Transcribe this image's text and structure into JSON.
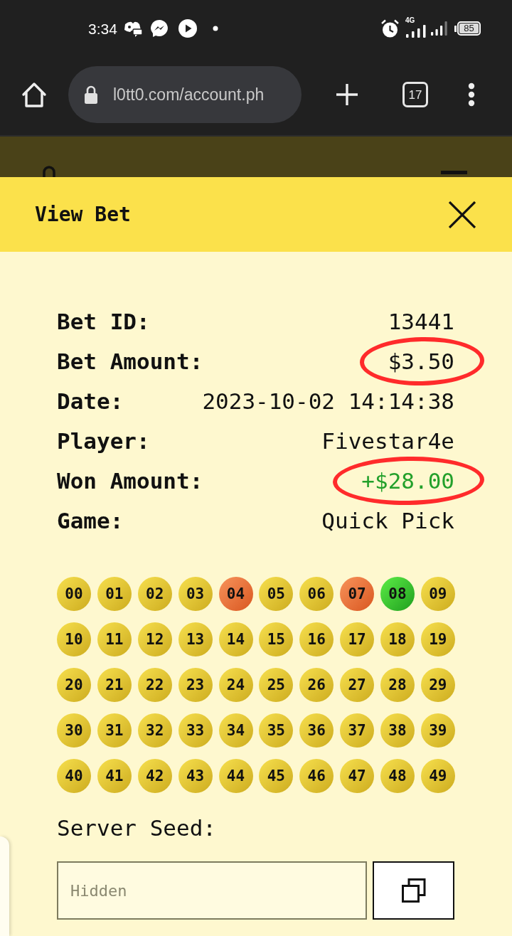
{
  "status_bar": {
    "time": "3:34",
    "network": "4G",
    "battery": "85"
  },
  "browser": {
    "url": "l0tt0.com/account.ph",
    "tab_count": "17"
  },
  "modal": {
    "title": "View Bet",
    "details": [
      {
        "label": "Bet ID:",
        "value": "13441",
        "highlighted": false,
        "positive": false
      },
      {
        "label": "Bet Amount:",
        "value": "$3.50",
        "highlighted": true,
        "positive": false
      },
      {
        "label": "Date:",
        "value": "2023-10-02 14:14:38",
        "highlighted": false,
        "positive": false
      },
      {
        "label": "Player:",
        "value": "Fivestar4e",
        "highlighted": false,
        "positive": false
      },
      {
        "label": "Won Amount:",
        "value": "+$28.00",
        "highlighted": true,
        "positive": true
      },
      {
        "label": "Game:",
        "value": "Quick Pick",
        "highlighted": false,
        "positive": false
      }
    ],
    "balls": [
      {
        "number": "00",
        "kind": "plain"
      },
      {
        "number": "01",
        "kind": "plain"
      },
      {
        "number": "02",
        "kind": "plain"
      },
      {
        "number": "03",
        "kind": "plain"
      },
      {
        "number": "04",
        "kind": "picked"
      },
      {
        "number": "05",
        "kind": "plain"
      },
      {
        "number": "06",
        "kind": "plain"
      },
      {
        "number": "07",
        "kind": "picked"
      },
      {
        "number": "08",
        "kind": "hit"
      },
      {
        "number": "09",
        "kind": "plain"
      },
      {
        "number": "10",
        "kind": "plain"
      },
      {
        "number": "11",
        "kind": "plain"
      },
      {
        "number": "12",
        "kind": "plain"
      },
      {
        "number": "13",
        "kind": "plain"
      },
      {
        "number": "14",
        "kind": "plain"
      },
      {
        "number": "15",
        "kind": "plain"
      },
      {
        "number": "16",
        "kind": "plain"
      },
      {
        "number": "17",
        "kind": "plain"
      },
      {
        "number": "18",
        "kind": "plain"
      },
      {
        "number": "19",
        "kind": "plain"
      },
      {
        "number": "20",
        "kind": "plain"
      },
      {
        "number": "21",
        "kind": "plain"
      },
      {
        "number": "22",
        "kind": "plain"
      },
      {
        "number": "23",
        "kind": "plain"
      },
      {
        "number": "24",
        "kind": "plain"
      },
      {
        "number": "25",
        "kind": "plain"
      },
      {
        "number": "26",
        "kind": "plain"
      },
      {
        "number": "27",
        "kind": "plain"
      },
      {
        "number": "28",
        "kind": "plain"
      },
      {
        "number": "29",
        "kind": "plain"
      },
      {
        "number": "30",
        "kind": "plain"
      },
      {
        "number": "31",
        "kind": "plain"
      },
      {
        "number": "32",
        "kind": "plain"
      },
      {
        "number": "33",
        "kind": "plain"
      },
      {
        "number": "34",
        "kind": "plain"
      },
      {
        "number": "35",
        "kind": "plain"
      },
      {
        "number": "36",
        "kind": "plain"
      },
      {
        "number": "37",
        "kind": "plain"
      },
      {
        "number": "38",
        "kind": "plain"
      },
      {
        "number": "39",
        "kind": "plain"
      },
      {
        "number": "40",
        "kind": "plain"
      },
      {
        "number": "41",
        "kind": "plain"
      },
      {
        "number": "42",
        "kind": "plain"
      },
      {
        "number": "43",
        "kind": "plain"
      },
      {
        "number": "44",
        "kind": "plain"
      },
      {
        "number": "45",
        "kind": "plain"
      },
      {
        "number": "46",
        "kind": "plain"
      },
      {
        "number": "47",
        "kind": "plain"
      },
      {
        "number": "48",
        "kind": "plain"
      },
      {
        "number": "49",
        "kind": "plain"
      }
    ],
    "server_seed": {
      "label": "Server Seed:",
      "placeholder": "Hidden"
    }
  }
}
